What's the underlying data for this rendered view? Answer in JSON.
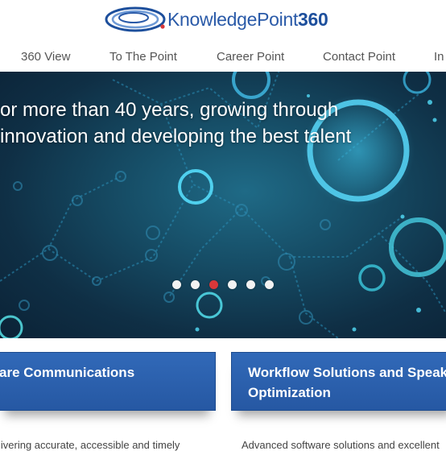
{
  "logo": {
    "name_prefix": "KnowledgePoint",
    "name_suffix": "360"
  },
  "nav": {
    "items": [
      {
        "label": "360 View"
      },
      {
        "label": "To The Point"
      },
      {
        "label": "Career Point"
      },
      {
        "label": "Contact Point"
      },
      {
        "label": "In"
      }
    ]
  },
  "hero": {
    "line1": "or more than 40 years, growing through",
    "line2": "innovation and developing the best talent",
    "slide_count": 6,
    "active_slide": 3
  },
  "cards": [
    {
      "title_line1": "are Communications",
      "title_line2": ""
    },
    {
      "title_line1": "Workflow Solutions and Speake",
      "title_line2": "Optimization"
    }
  ],
  "teasers": [
    {
      "text": "livering accurate, accessible and timely"
    },
    {
      "text": "Advanced software solutions and excellent"
    }
  ],
  "colors": {
    "brand_blue": "#2a5aa8",
    "card_blue": "#2c62b0",
    "active_dot": "#d8383a"
  }
}
